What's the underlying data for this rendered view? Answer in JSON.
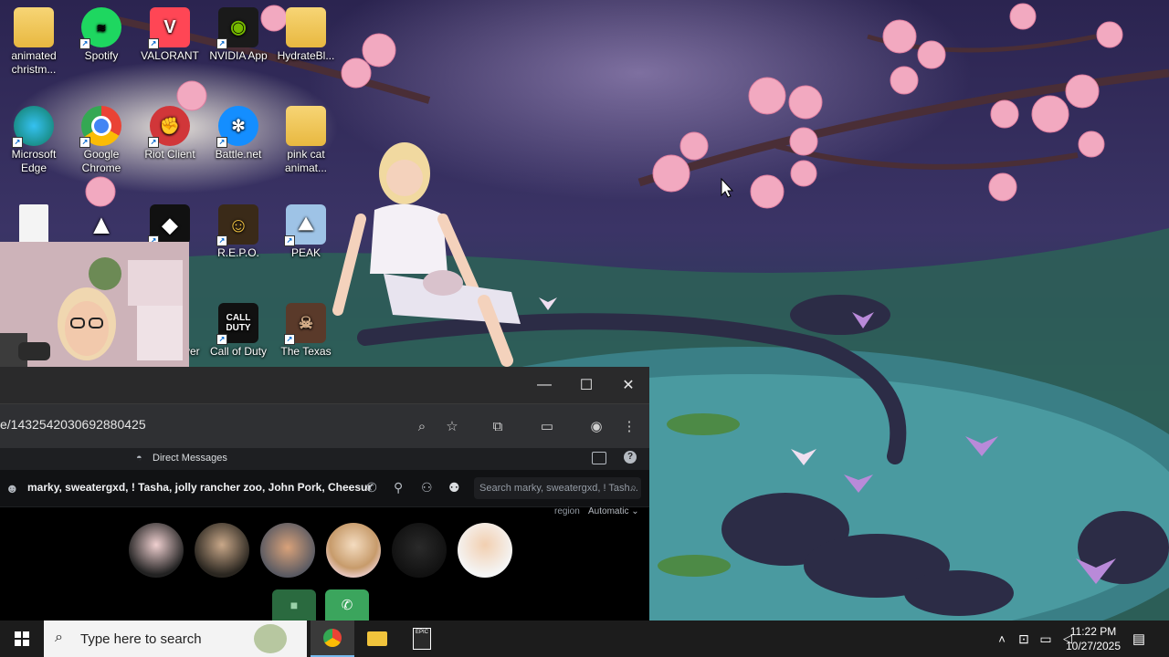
{
  "desktop": {
    "icons": [
      {
        "label": "animated christm...",
        "icon": "folder-icon"
      },
      {
        "label": "Spotify",
        "icon": "spotify-icon"
      },
      {
        "label": "VALORANT",
        "icon": "valorant-icon"
      },
      {
        "label": "NVIDIA App",
        "icon": "nvidia-icon"
      },
      {
        "label": "HydrateBl...",
        "icon": "folder-icon"
      },
      {
        "label": "Microsoft Edge",
        "icon": "edge-icon"
      },
      {
        "label": "Google Chrome",
        "icon": "chrome-icon"
      },
      {
        "label": "Riot Client",
        "icon": "riot-icon"
      },
      {
        "label": "Battle.net",
        "icon": "battlenet-icon"
      },
      {
        "label": "pink cat animat...",
        "icon": "folder-icon"
      },
      {
        "label": "",
        "icon": "document-icon"
      },
      {
        "label": "",
        "icon": "triangle-app-icon"
      },
      {
        "label": "",
        "icon": "roblox-icon"
      },
      {
        "label": "R.E.P.O.",
        "icon": "repo-game-icon"
      },
      {
        "label": "PEAK",
        "icon": "peak-game-icon"
      },
      {
        "label": "yer",
        "icon": "partial-app-icon"
      },
      {
        "label": "Call of Duty",
        "icon": "call-of-duty-icon"
      },
      {
        "label": "The Texas",
        "icon": "texas-chain-saw-icon"
      }
    ]
  },
  "browser": {
    "address": "e/1432542030692880425",
    "window_controls": {
      "minimize": "—",
      "maximize": "☐",
      "close": "✕"
    }
  },
  "discord": {
    "header_title": "Direct Messages",
    "channel_name": "marky, sweatergxd, ! Tasha, jolly rancher zoo, John Pork, Cheesur",
    "search_placeholder": "Search marky, sweatergxd, ! Tash...",
    "region_label": "region",
    "region_value": "Automatic",
    "participants_count": 6
  },
  "taskbar": {
    "search_placeholder": "Type here to search",
    "time": "11:22 PM",
    "date": "10/27/2025"
  },
  "colors": {
    "accent_green": "#3ba55d",
    "taskbar_bg": "#1c1c1c",
    "discord_bg": "#000000"
  }
}
